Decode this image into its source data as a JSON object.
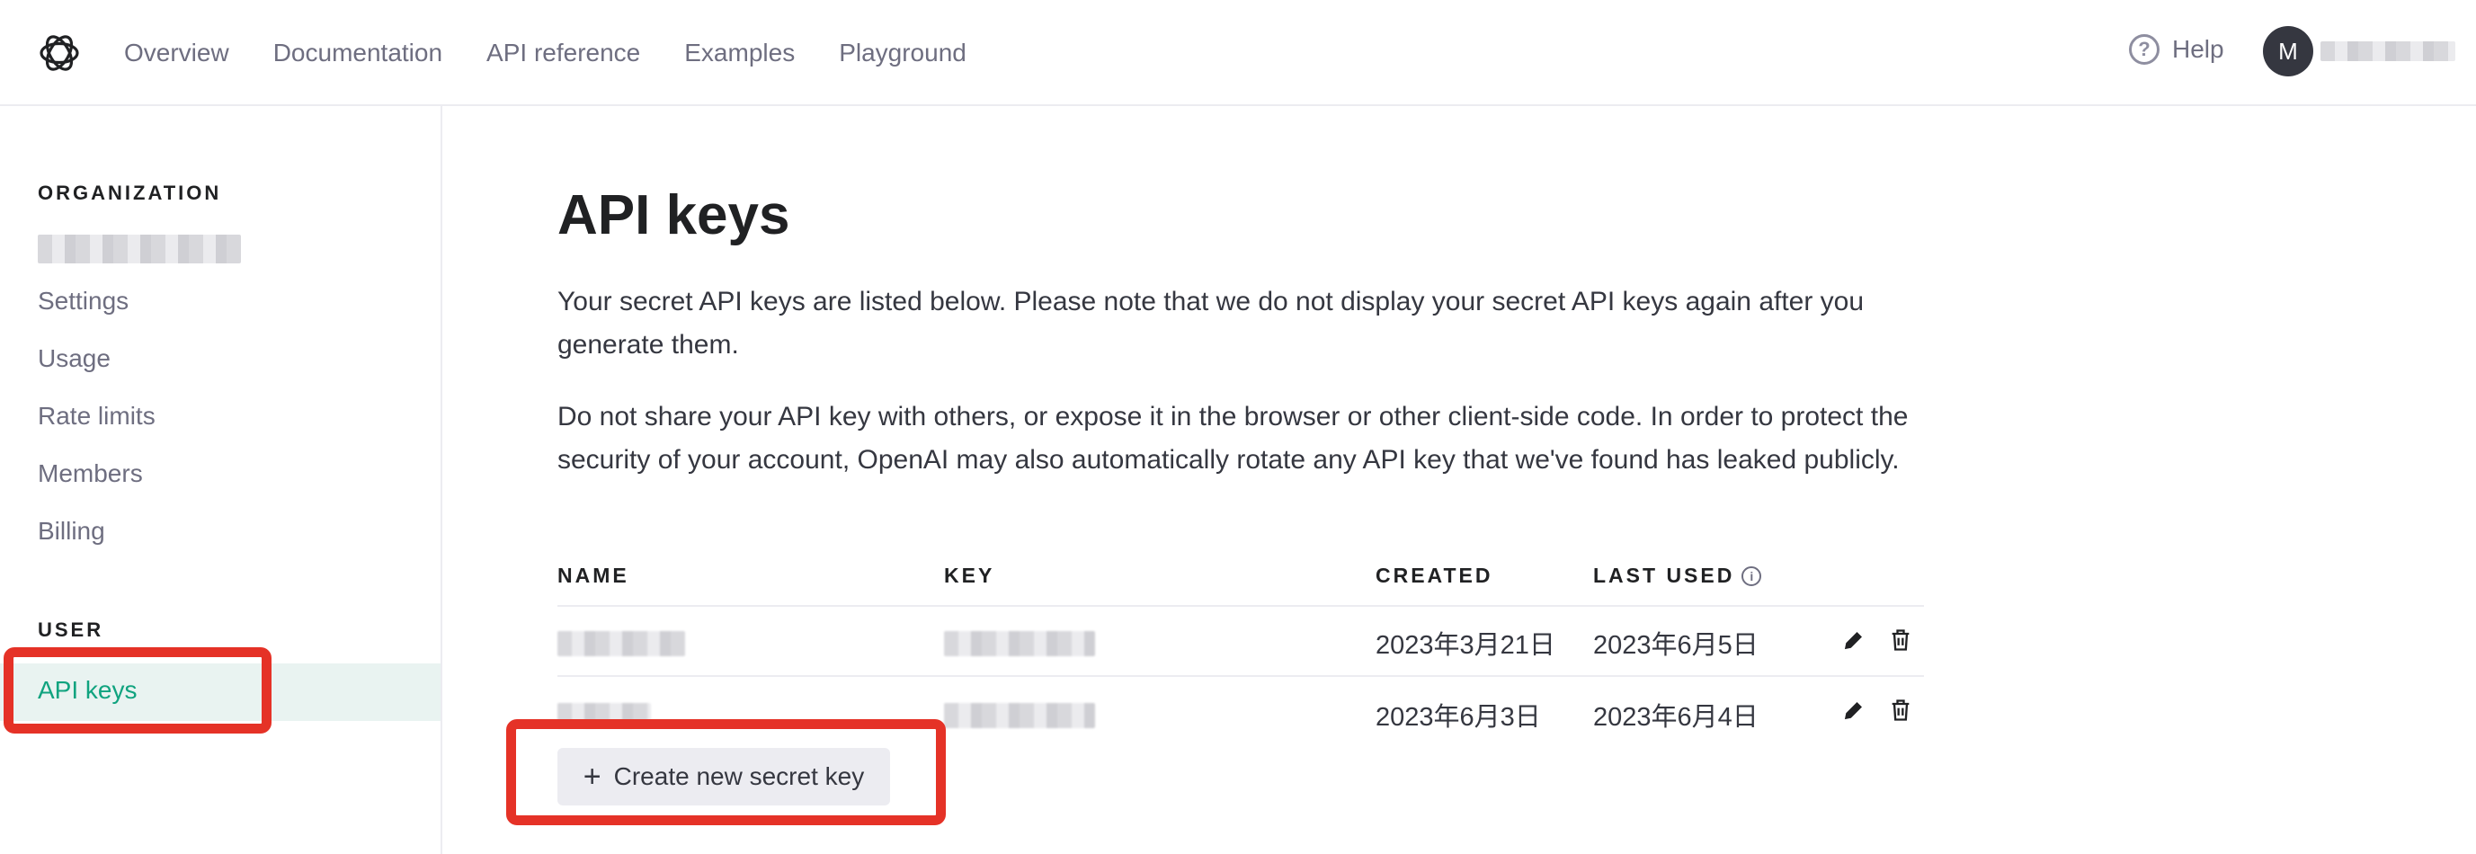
{
  "nav": {
    "logo_icon": "openai-logo-icon",
    "links": [
      "Overview",
      "Documentation",
      "API reference",
      "Examples",
      "Playground"
    ],
    "help_label": "Help",
    "account_initial": "M"
  },
  "sidebar": {
    "org_heading": "ORGANIZATION",
    "org_items": [
      "Settings",
      "Usage",
      "Rate limits",
      "Members",
      "Billing"
    ],
    "user_heading": "USER",
    "user_items": [
      "API keys"
    ],
    "active_item": "API keys"
  },
  "main": {
    "title": "API keys",
    "paragraph1": "Your secret API keys are listed below. Please note that we do not display your secret API keys again after you generate them.",
    "paragraph2": "Do not share your API key with others, or expose it in the browser or other client-side code. In order to protect the security of your account, OpenAI may also automatically rotate any API key that we've found has leaked publicly.",
    "table": {
      "headers": {
        "name": "NAME",
        "key": "KEY",
        "created": "CREATED",
        "last_used": "LAST USED"
      },
      "rows": [
        {
          "created": "2023年3月21日",
          "last_used": "2023年6月5日"
        },
        {
          "created": "2023年6月3日",
          "last_used": "2023年6月4日"
        }
      ]
    },
    "create_button": "Create new secret key"
  },
  "colors": {
    "accent": "#10a37f",
    "annotation_red": "#e53227",
    "active_bg": "#e9f3f1"
  }
}
